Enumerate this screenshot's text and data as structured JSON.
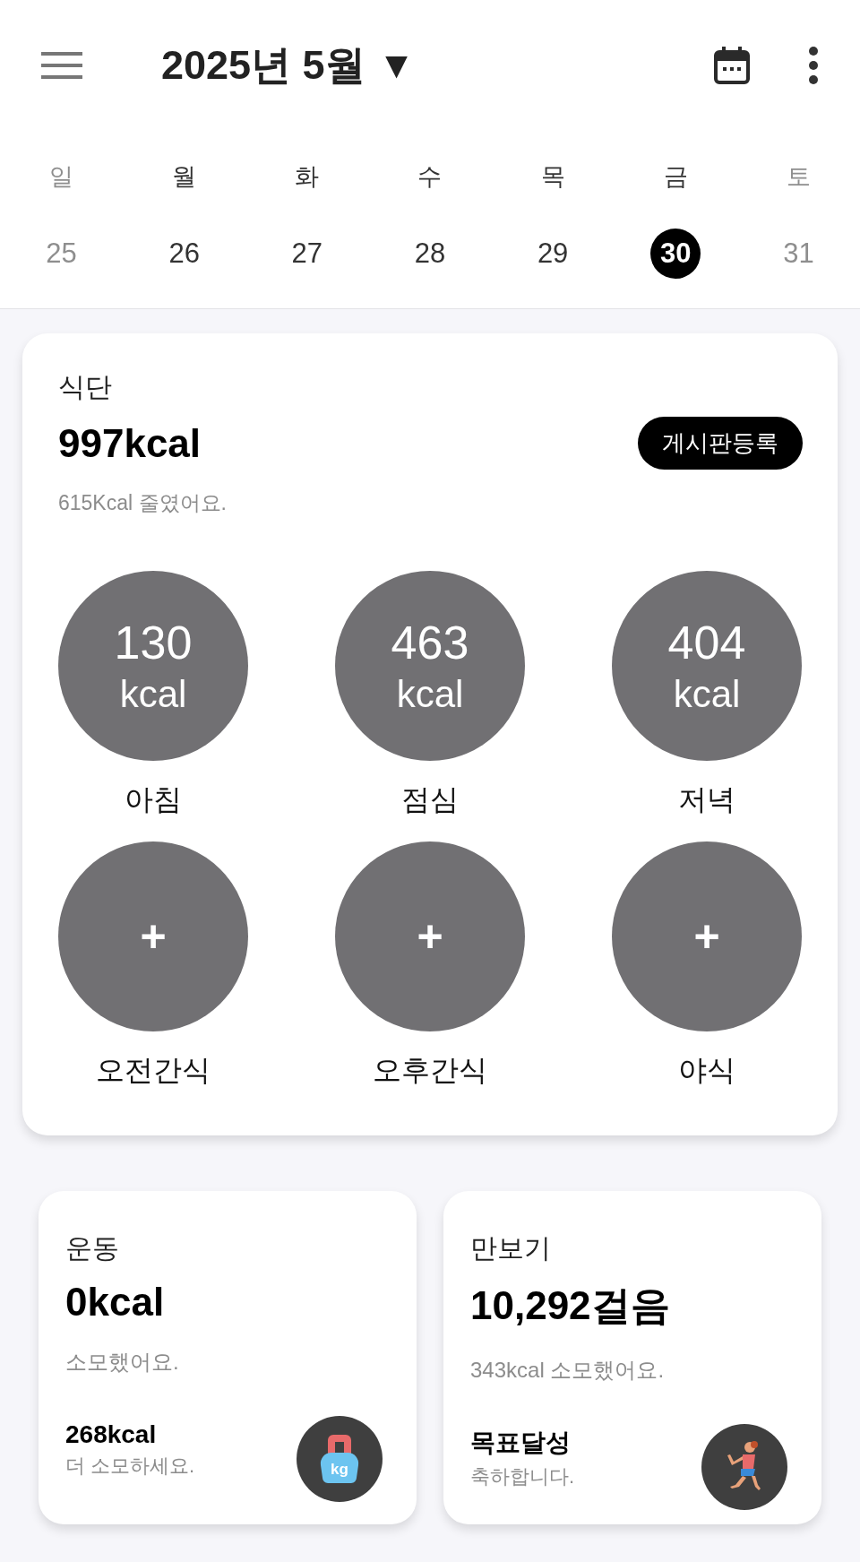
{
  "header": {
    "title": "2025년 5월",
    "dropdown": "▼"
  },
  "weekdays": [
    {
      "label": "일",
      "muted": true
    },
    {
      "label": "월",
      "muted": false
    },
    {
      "label": "화",
      "muted": false
    },
    {
      "label": "수",
      "muted": false
    },
    {
      "label": "목",
      "muted": false
    },
    {
      "label": "금",
      "muted": false
    },
    {
      "label": "토",
      "muted": true
    }
  ],
  "dates": [
    {
      "label": "25",
      "muted": true,
      "selected": false
    },
    {
      "label": "26",
      "muted": false,
      "selected": false
    },
    {
      "label": "27",
      "muted": false,
      "selected": false
    },
    {
      "label": "28",
      "muted": false,
      "selected": false
    },
    {
      "label": "29",
      "muted": false,
      "selected": false
    },
    {
      "label": "30",
      "muted": false,
      "selected": true
    },
    {
      "label": "31",
      "muted": true,
      "selected": false
    }
  ],
  "diet": {
    "title": "식단",
    "total": "997kcal",
    "button": "게시판등록",
    "note": "615Kcal 줄였어요.",
    "meals": [
      {
        "kind": "logged",
        "value": "130",
        "unit": "kcal",
        "label": "아침"
      },
      {
        "kind": "logged",
        "value": "463",
        "unit": "kcal",
        "label": "점심"
      },
      {
        "kind": "logged",
        "value": "404",
        "unit": "kcal",
        "label": "저녁"
      },
      {
        "kind": "empty",
        "plus": "+",
        "label": "오전간식"
      },
      {
        "kind": "empty",
        "plus": "+",
        "label": "오후간식"
      },
      {
        "kind": "empty",
        "plus": "+",
        "label": "야식"
      }
    ]
  },
  "cards": [
    {
      "kind": "exercise",
      "title": "운동",
      "value": "0kcal",
      "note": "소모했어요.",
      "goal": "268kcal",
      "goal_note": "더 소모하세요.",
      "icon_text": "kg"
    },
    {
      "kind": "steps",
      "title": "만보기",
      "value": "10,292걸음",
      "note": "343kcal 소모했어요.",
      "goal": "목표달성",
      "goal_note": "축하합니다."
    }
  ]
}
